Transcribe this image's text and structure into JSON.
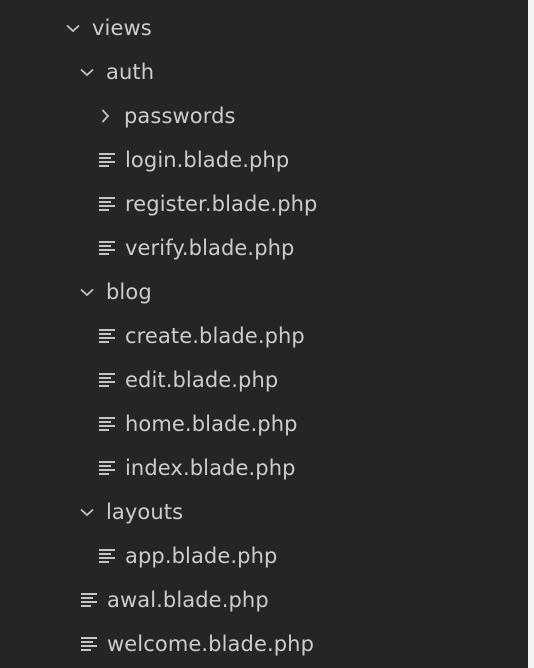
{
  "explorer": {
    "colors": {
      "background": "#252526",
      "text": "#cccccc",
      "icon": "#c5c5c5"
    },
    "items": [
      {
        "id": "views",
        "label": "views",
        "type": "folder",
        "expanded": true,
        "depth": 0,
        "icon": "chevron-down-icon"
      },
      {
        "id": "auth",
        "label": "auth",
        "type": "folder",
        "expanded": true,
        "depth": 1,
        "icon": "chevron-down-icon"
      },
      {
        "id": "passwords",
        "label": "passwords",
        "type": "folder",
        "expanded": false,
        "depth": 2,
        "icon": "chevron-right-icon"
      },
      {
        "id": "login",
        "label": "login.blade.php",
        "type": "file",
        "depth": 2,
        "icon": "file-lines-icon"
      },
      {
        "id": "register",
        "label": "register.blade.php",
        "type": "file",
        "depth": 2,
        "icon": "file-lines-icon"
      },
      {
        "id": "verify",
        "label": "verify.blade.php",
        "type": "file",
        "depth": 2,
        "icon": "file-lines-icon"
      },
      {
        "id": "blog",
        "label": "blog",
        "type": "folder",
        "expanded": true,
        "depth": 1,
        "icon": "chevron-down-icon"
      },
      {
        "id": "create",
        "label": "create.blade.php",
        "type": "file",
        "depth": 2,
        "icon": "file-lines-icon"
      },
      {
        "id": "edit",
        "label": "edit.blade.php",
        "type": "file",
        "depth": 2,
        "icon": "file-lines-icon"
      },
      {
        "id": "home",
        "label": "home.blade.php",
        "type": "file",
        "depth": 2,
        "icon": "file-lines-icon"
      },
      {
        "id": "index",
        "label": "index.blade.php",
        "type": "file",
        "depth": 2,
        "icon": "file-lines-icon"
      },
      {
        "id": "layouts",
        "label": "layouts",
        "type": "folder",
        "expanded": true,
        "depth": 1,
        "icon": "chevron-down-icon"
      },
      {
        "id": "app",
        "label": "app.blade.php",
        "type": "file",
        "depth": 2,
        "icon": "file-lines-icon"
      },
      {
        "id": "awal",
        "label": "awal.blade.php",
        "type": "file",
        "depth": 1,
        "icon": "file-lines-icon"
      },
      {
        "id": "welcome",
        "label": "welcome.blade.php",
        "type": "file",
        "depth": 1,
        "icon": "file-lines-icon"
      }
    ]
  }
}
